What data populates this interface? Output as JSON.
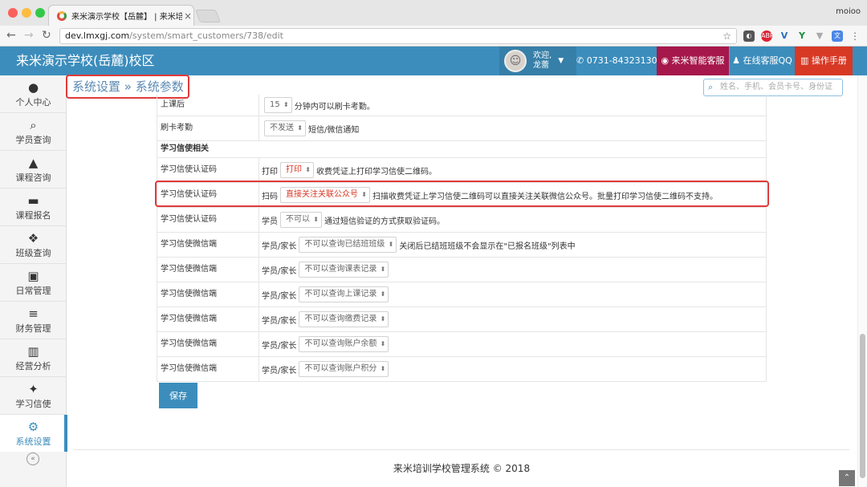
{
  "browser": {
    "tab_title": "来米演示学校【岳麓】 | 来米培",
    "tab_close": "×",
    "profile": "moioo",
    "url_host": "dev.lmxgj.com",
    "url_path": "/system/smart_customers/738/edit",
    "extensions": [
      "ABP",
      "V",
      "Y"
    ]
  },
  "header": {
    "school_name": "来米演示学校(岳麓)校区",
    "welcome": "欢迎,",
    "user_name": "龙蕾",
    "phone": "0731-84323130",
    "ai_service": "来米智能客服",
    "qq_service": "在线客服QQ",
    "manual": "操作手册"
  },
  "sidebar": {
    "items": [
      {
        "label": "个人中心",
        "icon": "user-icon"
      },
      {
        "label": "学员查询",
        "icon": "search-icon"
      },
      {
        "label": "课程咨询",
        "icon": "graduation-cap-icon"
      },
      {
        "label": "课程报名",
        "icon": "cart-icon"
      },
      {
        "label": "班级查询",
        "icon": "cubes-icon"
      },
      {
        "label": "日常管理",
        "icon": "desktop-icon"
      },
      {
        "label": "财务管理",
        "icon": "list-icon"
      },
      {
        "label": "经营分析",
        "icon": "bar-chart-icon"
      },
      {
        "label": "学习信使",
        "icon": "twitter-bird-icon"
      },
      {
        "label": "系统设置",
        "icon": "gears-icon",
        "active": true
      }
    ]
  },
  "breadcrumb": "系统设置 » 系统参数",
  "search": {
    "placeholder": "姓名、手机、会员卡号、身份证"
  },
  "rows": [
    {
      "label": "上课后",
      "prefix": "",
      "select": "15",
      "suffix": "分钟内可以刷卡考勤。"
    },
    {
      "label": "刷卡考勤",
      "prefix": "",
      "select": "不发送",
      "suffix": "短信/微信通知"
    },
    {
      "label": "学习信使相关",
      "section": true
    },
    {
      "label": "学习信使认证码",
      "prefix": "打印",
      "select": "打印",
      "suffix": "收费凭证上打印学习信使二维码。",
      "red": true
    },
    {
      "label": "学习信使认证码",
      "prefix": "扫码",
      "select": "直接关注关联公众号",
      "suffix": "扫描收费凭证上学习信使二维码可以直接关注关联微信公众号。批量打印学习信使二维码不支持。",
      "red": true
    },
    {
      "label": "学习信使认证码",
      "prefix": "学员",
      "select": "不可以",
      "suffix": "通过短信验证的方式获取验证码。"
    },
    {
      "label": "学习信使微信端",
      "prefix": "学员/家长",
      "select": "不可以查询已结班班级",
      "suffix": "关闭后已结班班级不会显示在\"已报名班级\"列表中"
    },
    {
      "label": "学习信使微信端",
      "prefix": "学员/家长",
      "select": "不可以查询课表记录",
      "suffix": ""
    },
    {
      "label": "学习信使微信端",
      "prefix": "学员/家长",
      "select": "不可以查询上课记录",
      "suffix": ""
    },
    {
      "label": "学习信使微信端",
      "prefix": "学员/家长",
      "select": "不可以查询缴费记录",
      "suffix": ""
    },
    {
      "label": "学习信使微信端",
      "prefix": "学员/家长",
      "select": "不可以查询账户余额",
      "suffix": ""
    },
    {
      "label": "学习信使微信端",
      "prefix": "学员/家长",
      "select": "不可以查询账户积分",
      "suffix": ""
    }
  ],
  "save_label": "保存",
  "footer": "来米培训学校管理系统 © 2018",
  "colors": {
    "primary": "#3c8dbc",
    "highlight": "#e23a3a",
    "danger": "#d73925"
  }
}
